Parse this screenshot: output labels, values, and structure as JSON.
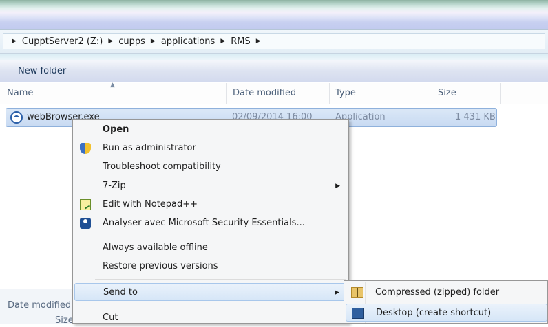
{
  "address": {
    "crumbs": [
      "CupptServer2 (Z:)",
      "cupps",
      "applications",
      "RMS"
    ]
  },
  "toolbar": {
    "new_folder": "New folder"
  },
  "columns": {
    "name": "Name",
    "date": "Date modified",
    "type": "Type",
    "size": "Size"
  },
  "file": {
    "name": "webBrowser.exe",
    "date": "02/09/2014 16:00",
    "type": "Application",
    "size": "1 431 KB"
  },
  "details": {
    "date_label": "Date modified",
    "size_label": "Size"
  },
  "context_menu": {
    "items": [
      {
        "label": "Open",
        "icon": ""
      },
      {
        "label": "Run as administrator",
        "icon": "shield-icon"
      },
      {
        "label": "Troubleshoot compatibility",
        "icon": ""
      },
      {
        "label": "7-Zip",
        "icon": "",
        "submenu": true
      },
      {
        "label": "Edit with Notepad++",
        "icon": "notepad-plus-plus-icon"
      },
      {
        "label": "Analyser avec Microsoft Security Essentials...",
        "icon": "security-essentials-icon"
      },
      {
        "label": "Always available offline",
        "icon": ""
      },
      {
        "label": "Restore previous versions",
        "icon": ""
      },
      {
        "label": "Send to",
        "icon": "",
        "submenu": true
      },
      {
        "label": "Cut",
        "icon": ""
      }
    ]
  },
  "send_to_menu": {
    "items": [
      {
        "label": "Compressed (zipped) folder",
        "icon": "zip-folder-icon"
      },
      {
        "label": "Desktop (create shortcut)",
        "icon": "desktop-icon"
      }
    ]
  }
}
